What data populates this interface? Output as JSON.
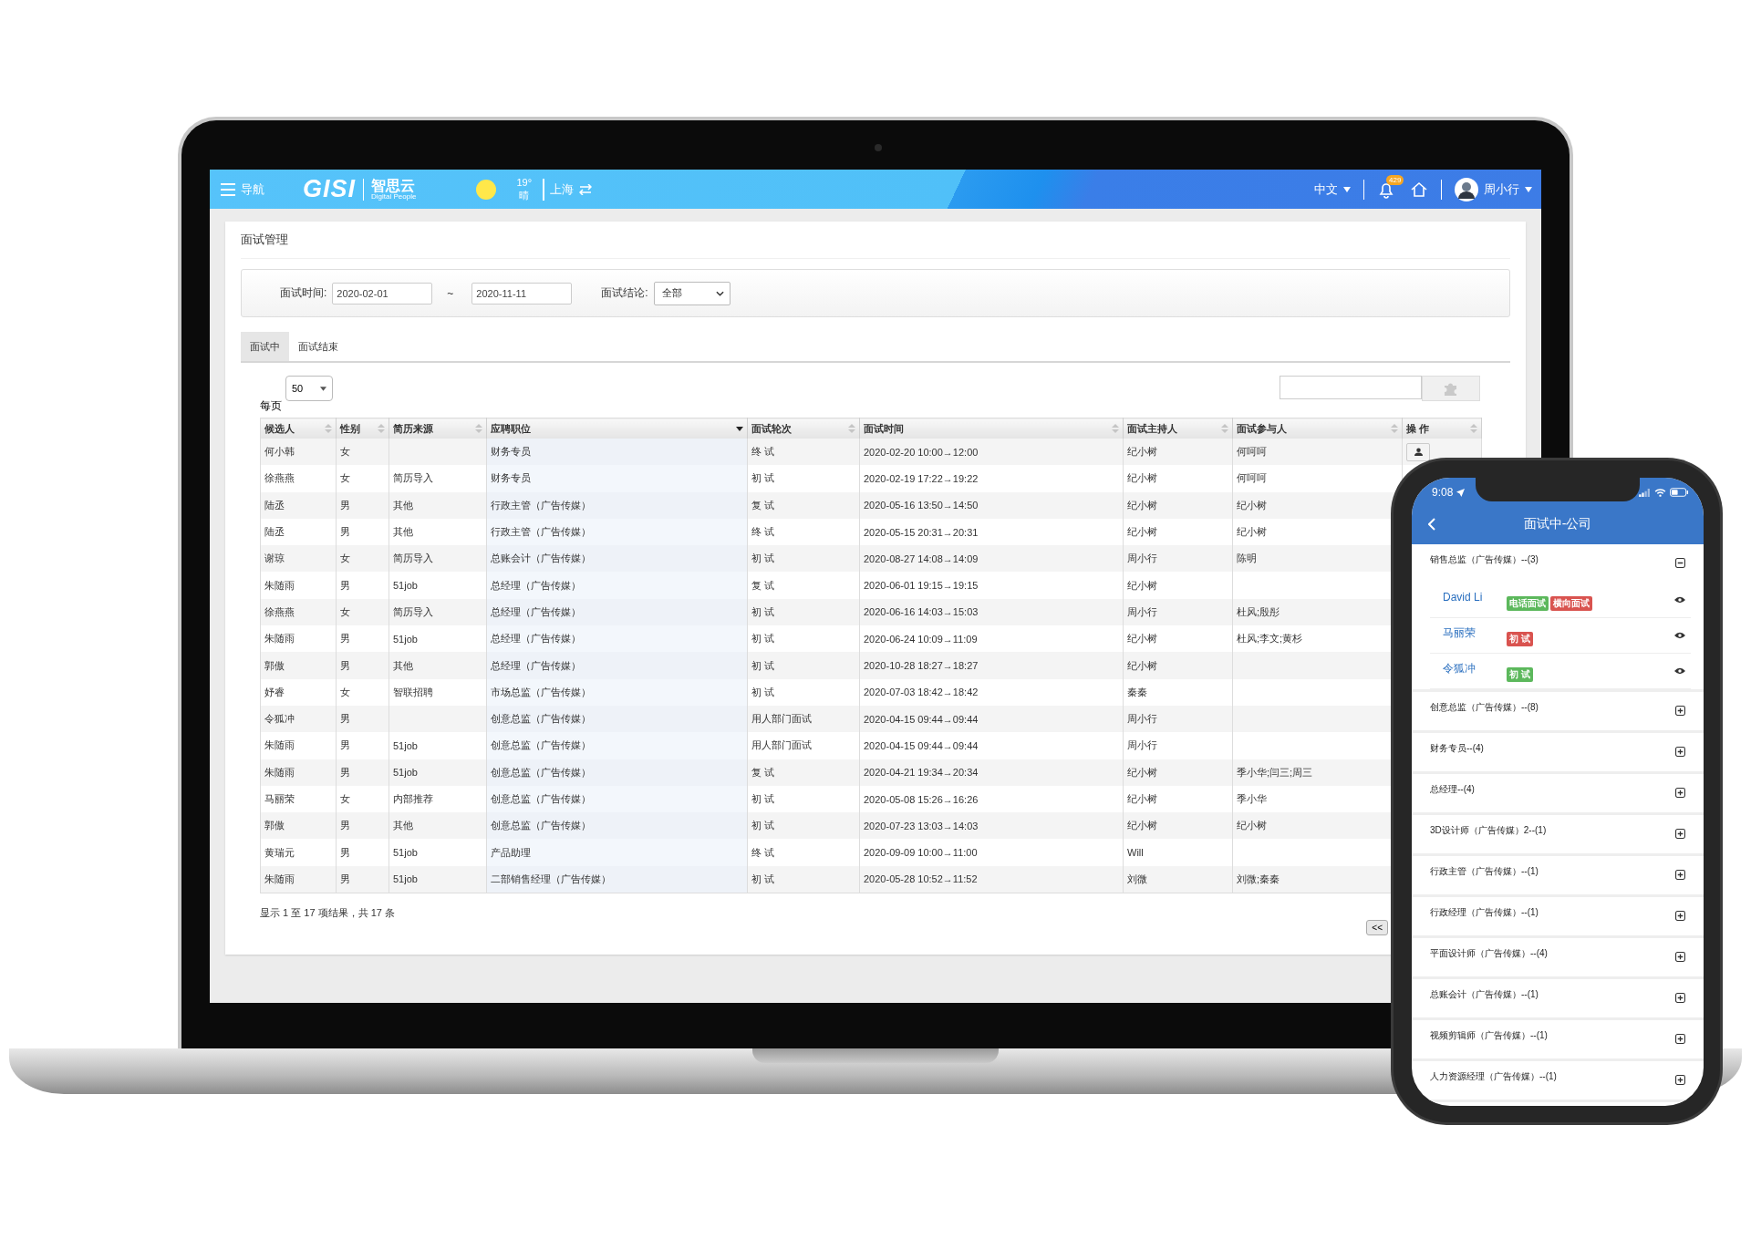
{
  "laptop": {
    "header": {
      "nav_label": "导航",
      "logo_text": "GISI",
      "logo_cn": "智思云",
      "logo_sub": "Digital People",
      "temperature": "19°",
      "weather": "晴",
      "city": "上海",
      "language": "中文",
      "notification_count": "429",
      "user_name": "周小行"
    },
    "page_title": "面试管理",
    "filter": {
      "time_label": "面试时间:",
      "date_from": "2020-02-01",
      "separator": "~",
      "date_to": "2020-11-11",
      "result_label": "面试结论:",
      "result_value": "全部"
    },
    "tabs": [
      {
        "label": "面试中",
        "selected": true
      },
      {
        "label": "面试结束",
        "selected": false
      }
    ],
    "page_size_label": "每页",
    "page_size": "50",
    "table": {
      "columns": [
        {
          "label": "候选人",
          "sorted": false
        },
        {
          "label": "性别",
          "sorted": false
        },
        {
          "label": "简历来源",
          "sorted": false
        },
        {
          "label": "应聘职位",
          "sorted": true
        },
        {
          "label": "面试轮次",
          "sorted": false
        },
        {
          "label": "面试时间",
          "sorted": false
        },
        {
          "label": "面试主持人",
          "sorted": false
        },
        {
          "label": "面试参与人",
          "sorted": false
        },
        {
          "label": "操 作",
          "sorted": false
        }
      ],
      "rows": [
        {
          "candidate": "何小韩",
          "gender": "女",
          "position": "财务专员",
          "round": "终 试",
          "time": "2020-02-20 10:00→12:00",
          "host": "纪小树",
          "participants": "何呵呵",
          "action": true
        },
        {
          "candidate": "徐燕燕",
          "gender": "女",
          "source": "简历导入",
          "position": "财务专员",
          "round": "初 试",
          "time": "2020-02-19 17:22→19:22",
          "host": "纪小树",
          "participants": "何呵呵"
        },
        {
          "candidate": "陆丞",
          "gender": "男",
          "source": "其他",
          "position": "行政主管（广告传媒）",
          "round": "复 试",
          "time": "2020-05-16 13:50→14:50",
          "host": "纪小树",
          "participants": "纪小树"
        },
        {
          "candidate": "陆丞",
          "gender": "男",
          "source": "其他",
          "position": "行政主管（广告传媒）",
          "round": "终 试",
          "time": "2020-05-15 20:31→20:31",
          "host": "纪小树",
          "participants": "纪小树"
        },
        {
          "candidate": "谢琼",
          "gender": "女",
          "source": "简历导入",
          "position": "总账会计（广告传媒）",
          "round": "初 试",
          "time": "2020-08-27 14:08→14:09",
          "host": "周小行",
          "participants": "陈明"
        },
        {
          "candidate": "朱随雨",
          "gender": "男",
          "source": "51job",
          "position": "总经理（广告传媒）",
          "round": "复 试",
          "time": "2020-06-01 19:15→19:15",
          "host": "纪小树"
        },
        {
          "candidate": "徐燕燕",
          "gender": "女",
          "source": "简历导入",
          "position": "总经理（广告传媒）",
          "round": "初 试",
          "time": "2020-06-16 14:03→15:03",
          "host": "周小行",
          "participants": "杜风;殷彤"
        },
        {
          "candidate": "朱随雨",
          "gender": "男",
          "source": "51job",
          "position": "总经理（广告传媒）",
          "round": "初 试",
          "time": "2020-06-24 10:09→11:09",
          "host": "纪小树",
          "participants": "杜风;李文;黄杉"
        },
        {
          "candidate": "郭傲",
          "gender": "男",
          "source": "其他",
          "position": "总经理（广告传媒）",
          "round": "初 试",
          "time": "2020-10-28 18:27→18:27",
          "host": "纪小树"
        },
        {
          "candidate": "妤睿",
          "gender": "女",
          "source": "智联招聘",
          "position": "市场总监（广告传媒）",
          "round": "初 试",
          "time": "2020-07-03 18:42→18:42",
          "host": "秦秦"
        },
        {
          "candidate": "令狐冲",
          "gender": "男",
          "position": "创意总监（广告传媒）",
          "round": "用人部门面试",
          "time": "2020-04-15 09:44→09:44",
          "host": "周小行"
        },
        {
          "candidate": "朱随雨",
          "gender": "男",
          "source": "51job",
          "position": "创意总监（广告传媒）",
          "round": "用人部门面试",
          "time": "2020-04-15 09:44→09:44",
          "host": "周小行"
        },
        {
          "candidate": "朱随雨",
          "gender": "男",
          "source": "51job",
          "position": "创意总监（广告传媒）",
          "round": "复 试",
          "time": "2020-04-21 19:34→20:34",
          "host": "纪小树",
          "participants": "季小华;闫三;周三"
        },
        {
          "candidate": "马丽荣",
          "gender": "女",
          "source": "内部推荐",
          "position": "创意总监（广告传媒）",
          "round": "初 试",
          "time": "2020-05-08 15:26→16:26",
          "host": "纪小树",
          "participants": "季小华"
        },
        {
          "candidate": "郭傲",
          "gender": "男",
          "source": "其他",
          "position": "创意总监（广告传媒）",
          "round": "初 试",
          "time": "2020-07-23 13:03→14:03",
          "host": "纪小树",
          "participants": "纪小树"
        },
        {
          "candidate": "黄瑞元",
          "gender": "男",
          "source": "51job",
          "position": "产品助理",
          "round": "终 试",
          "time": "2020-09-09 10:00→11:00",
          "host": "Will"
        },
        {
          "candidate": "朱随雨",
          "gender": "男",
          "source": "51job",
          "position": "二部销售经理（广告传媒）",
          "round": "初 试",
          "time": "2020-05-28 10:52→11:52",
          "host": "刘微",
          "participants": "刘微;秦秦"
        }
      ]
    },
    "summary": "显示 1 至 17 项结果，共 17 条",
    "pager_button": "<<"
  },
  "phone": {
    "time": "9:08",
    "title": "面试中-公司",
    "groups": [
      {
        "label": "销售总监（广告传媒）--(3)",
        "expanded": true,
        "children": [
          {
            "name": "David Li",
            "tags": [
              {
                "label": "电话面试",
                "color": "#5cb85c"
              },
              {
                "label": "横向面试",
                "color": "#d9534f"
              }
            ]
          },
          {
            "name": "马丽荣",
            "tags": [
              {
                "label": "初 试",
                "color": "#d9534f"
              }
            ]
          },
          {
            "name": "令狐冲",
            "tags": [
              {
                "label": "初 试",
                "color": "#5cb85c"
              }
            ]
          }
        ]
      },
      {
        "label": "创意总监（广告传媒）--(8)",
        "expanded": false
      },
      {
        "label": "财务专员--(4)",
        "expanded": false
      },
      {
        "label": "总经理--(4)",
        "expanded": false
      },
      {
        "label": "3D设计师（广告传媒）2--(1)",
        "expanded": false
      },
      {
        "label": "行政主管（广告传媒）--(1)",
        "expanded": false
      },
      {
        "label": "行政经理（广告传媒）--(1)",
        "expanded": false
      },
      {
        "label": "平面设计师（广告传媒）--(4)",
        "expanded": false
      },
      {
        "label": "总账会计（广告传媒）--(1)",
        "expanded": false
      },
      {
        "label": "视频剪辑师（广告传媒）--(1)",
        "expanded": false
      },
      {
        "label": "人力资源经理（广告传媒）--(1)",
        "expanded": false
      }
    ]
  }
}
